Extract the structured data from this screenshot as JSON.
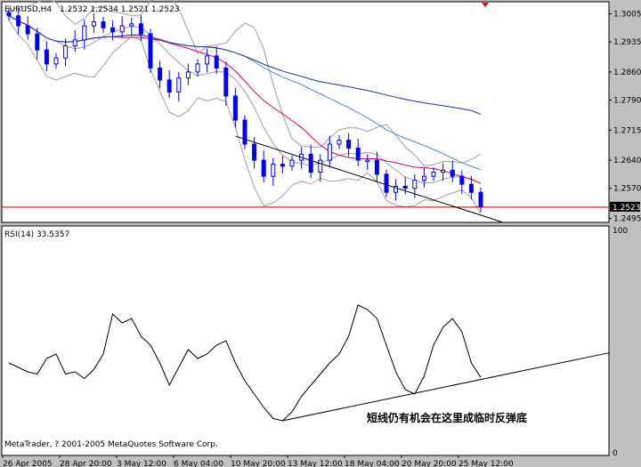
{
  "main_info": {
    "symbol_timeframe": "EURUSD,H4",
    "ohlc": "1.2532 1.2534 1.2521 1.2523"
  },
  "rsi_info": {
    "label": "RSI(14) 33.5357"
  },
  "price_axis": {
    "ticks": [
      "1.3005",
      "1.2935",
      "1.2860",
      "1.2790",
      "1.2715",
      "1.2640",
      "1.2570",
      "1.2495"
    ],
    "current_price": "1.2523",
    "range": [
      1.2485,
      1.3035
    ]
  },
  "rsi_axis": {
    "ticks": [
      "100",
      "0"
    ],
    "range": [
      0,
      100
    ]
  },
  "time_axis": {
    "labels": [
      "26 Apr 2005",
      "28 Apr 20:00",
      "3 May 12:00",
      "6 May 04:00",
      "10 May 20:00",
      "13 May 12:00",
      "18 May 04:00",
      "20 May 20:00",
      "25 May 12:00"
    ]
  },
  "annotation": {
    "text": "短线仍有机会在这里成临时反弹底"
  },
  "copyright": "MetaTrader, ? 2001-2005 MetaQuotes Software Corp.",
  "colors": {
    "candle": "#0000ff",
    "bollinger": "#a0a0a0",
    "ma_fast": "#d3006a",
    "ma_slow": "#1a2ea8",
    "ma_mid": "#4a8ad0",
    "current_line": "#b00000",
    "trendline": "#000000",
    "rsi_line": "#000000",
    "marker": "#ff0000"
  },
  "chart_data": [
    {
      "type": "candlestick",
      "title": "EURUSD,H4",
      "x": [
        "26 Apr 2005",
        "28 Apr 20:00",
        "3 May 12:00",
        "6 May 04:00",
        "10 May 20:00",
        "13 May 12:00",
        "18 May 04:00",
        "20 May 20:00",
        "25 May 12:00"
      ],
      "close_series": [
        1.3,
        1.2975,
        1.2955,
        1.2915,
        1.288,
        1.2895,
        1.2925,
        1.294,
        1.2975,
        1.2985,
        1.297,
        1.296,
        1.2975,
        1.298,
        1.2955,
        1.287,
        1.284,
        1.281,
        1.2845,
        1.286,
        1.288,
        1.29,
        1.287,
        1.28,
        1.274,
        1.268,
        1.264,
        1.26,
        1.263,
        1.2625,
        1.264,
        1.2655,
        1.261,
        1.264,
        1.268,
        1.269,
        1.267,
        1.264,
        1.264,
        1.2605,
        1.256,
        1.2575,
        1.257,
        1.259,
        1.26,
        1.261,
        1.2615,
        1.26,
        1.258,
        1.256,
        1.2523
      ],
      "current_price": 1.2523,
      "ylim": [
        1.2485,
        1.3035
      ],
      "overlays": [
        "Bollinger Bands",
        "moving averages"
      ]
    },
    {
      "type": "line",
      "title": "RSI(14) 33.5357",
      "values": [
        40,
        38,
        36,
        35,
        42,
        44,
        35,
        36,
        33,
        37,
        44,
        62,
        58,
        60,
        52,
        48,
        40,
        30,
        38,
        46,
        42,
        44,
        48,
        50,
        40,
        32,
        26,
        20,
        15,
        14,
        18,
        25,
        30,
        35,
        40,
        44,
        52,
        66,
        64,
        60,
        48,
        36,
        28,
        26,
        34,
        48,
        56,
        60,
        54,
        40,
        33.5357
      ],
      "current_value": 33.5357,
      "ylim": [
        0,
        100
      ]
    }
  ]
}
